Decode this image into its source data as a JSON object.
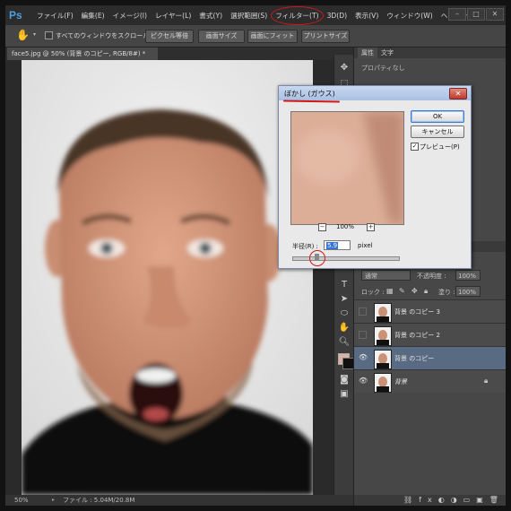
{
  "app": {
    "logo": "Ps"
  },
  "menu": [
    "ファイル(F)",
    "編集(E)",
    "イメージ(I)",
    "レイヤー(L)",
    "書式(Y)",
    "選択範囲(S)",
    "フィルター(T)",
    "3D(D)",
    "表示(V)",
    "ウィンドウ(W)",
    "ヘルプ(H)"
  ],
  "window_buttons": {
    "minimize": "–",
    "maximize": "□",
    "close": "✕"
  },
  "options_bar": {
    "scroll_all_label": "すべてのウィンドウをスクロール",
    "btn_actual_pixels": "ピクセル等倍",
    "btn_fit_screen": "画面サイズ",
    "btn_fill_screen": "画面にフィット",
    "btn_print_size": "プリントサイズ"
  },
  "document": {
    "tab_title": "face5.jpg @ 50% (背景 のコピー, RGB/8#) *",
    "zoom": "50%",
    "file_info": "ファイル : 5.04M/20.8M"
  },
  "properties_panel": {
    "tab_properties": "属性",
    "tab_character": "文字",
    "message": "プロパティなし"
  },
  "layers_panel": {
    "blend_mode": "通常",
    "opacity_label": "不透明度 :",
    "opacity_value": "100%",
    "lock_label": "ロック :",
    "fill_label": "塗り :",
    "fill_value": "100%",
    "layers": [
      {
        "name": "背景 のコピー 3",
        "visible": false,
        "selected": false
      },
      {
        "name": "背景 のコピー 2",
        "visible": false,
        "selected": false
      },
      {
        "name": "背景 のコピー",
        "visible": true,
        "selected": true
      },
      {
        "name": "背景",
        "visible": true,
        "selected": false
      }
    ]
  },
  "dialog": {
    "title": "ぼかし (ガウス)",
    "ok": "OK",
    "cancel": "キャンセル",
    "preview_label": "プレビュー(P)",
    "preview_checked": true,
    "zoom_minus": "−",
    "zoom_plus": "+",
    "zoom_value": "100%",
    "radius_label": "半径(R) :",
    "radius_value": "5.9",
    "radius_unit": "pixel"
  },
  "annotation_color": "#d01818"
}
